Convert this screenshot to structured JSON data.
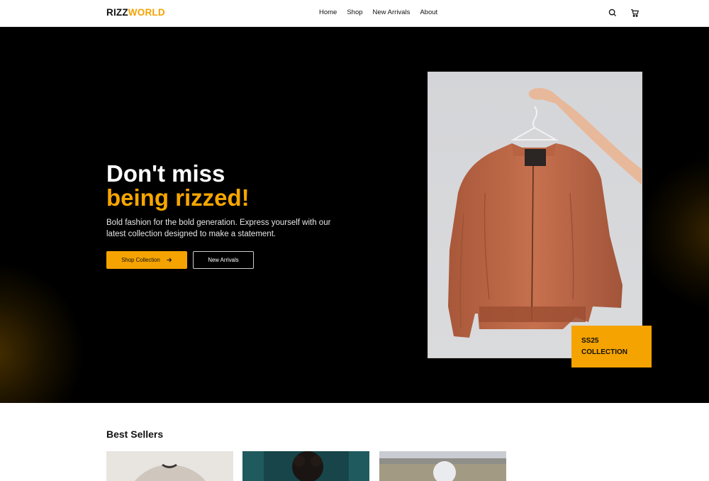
{
  "header": {
    "logo_part1": "RIZZ",
    "logo_part2": "WORLD",
    "nav": [
      "Home",
      "Shop",
      "New Arrivals",
      "About"
    ],
    "icons": [
      "search-icon",
      "cart-icon"
    ]
  },
  "hero": {
    "headline_line1": "Don't miss",
    "headline_line2": "being rizzed!",
    "subtext": "Bold fashion for the bold generation. Express yourself with our latest collection designed to make a statement.",
    "primary_button": "Shop Collection",
    "secondary_button": "New Arrivals",
    "badge_line1": "SS25",
    "badge_line2": "COLLECTION"
  },
  "best_sellers": {
    "title": "Best Sellers",
    "cards": 3
  },
  "colors": {
    "accent": "#f5a300",
    "hero_bg": "#000000",
    "text": "#111111"
  }
}
